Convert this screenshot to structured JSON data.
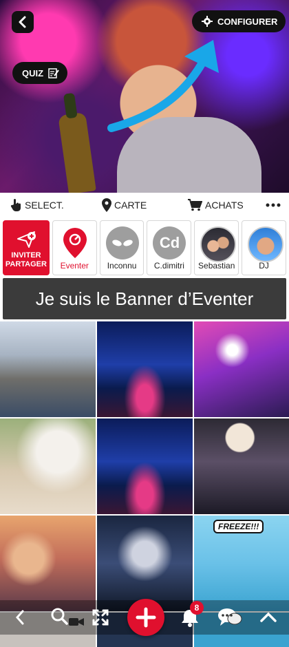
{
  "hero": {
    "configure_label": "CONFIGURER",
    "quiz_label": "QUIZ"
  },
  "toolbar": {
    "select_label": "SELECT.",
    "map_label": "CARTE",
    "purchases_label": "ACHATS"
  },
  "stories": {
    "invite_line1": "INVITER",
    "invite_line2": "PARTAGER",
    "items": [
      {
        "label": "Eventer",
        "avatar_text": ""
      },
      {
        "label": "Inconnu",
        "avatar_text": ""
      },
      {
        "label": "C.dimitri",
        "avatar_text": "Cd"
      },
      {
        "label": "Sebastian",
        "avatar_text": ""
      },
      {
        "label": "DJ",
        "avatar_text": ""
      }
    ]
  },
  "banner": {
    "text": "Je suis le Banner d’Eventer"
  },
  "grid": {
    "freeze_text": "FREEZE!!!"
  },
  "navbar": {
    "notification_count": "8"
  },
  "colors": {
    "accent": "#e0102e",
    "dark_pill": "#111111",
    "banner_bg": "#3b3b3b",
    "arrow": "#19a7e8"
  }
}
